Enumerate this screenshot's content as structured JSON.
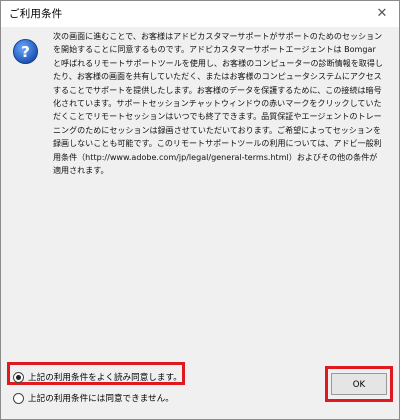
{
  "window": {
    "title": "ご利用条件",
    "close_glyph": "✕"
  },
  "icons": {
    "info": "question-icon"
  },
  "message": {
    "text": "次の画面に進むことで、お客様はアドビカスタマーサポートがサポートのためのセッションを開始することに同意するものです。アドビカスタマーサポートエージェントは Bomgar と呼ばれるリモートサポートツールを使用し、お客様のコンピューターの診断情報を取得したり、お客様の画面を共有していただく、またはお客様のコンピュータシステムにアクセスすることでサポートを提供したします。お客様のデータを保護するために、この接続は暗号化されています。サポートセッションチャットウィンドウの赤いマークをクリックしていただくことでリモートセッションはいつでも終了できます。品質保証やエージェントのトレーニングのためにセッションは録画させていただいております。ご希望によってセッションを録画しないことも可能です。このリモートサポートツールの利用については、アドビ一般利用条件（http://www.adobe.com/jp/legal/general-terms.html）およびその他の条件が適用されます。"
  },
  "options": {
    "agree": {
      "label": "上記の利用条件をよく読み同意します。",
      "selected": true
    },
    "disagree": {
      "label": "上記の利用条件には同意できません。",
      "selected": false
    }
  },
  "buttons": {
    "ok": "OK"
  },
  "colors": {
    "highlight": "#e0181f",
    "icon_blue": "#1f5fbf"
  }
}
